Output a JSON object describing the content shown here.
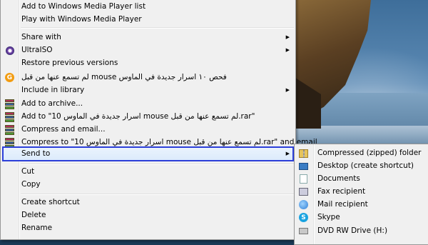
{
  "main_menu": {
    "items": [
      {
        "label": "Add to Windows Media Player list"
      },
      {
        "label": "Play with Windows Media Player"
      },
      {
        "label": "Share with",
        "arrow": "▶"
      },
      {
        "label": "UltraISO",
        "arrow": "▶"
      },
      {
        "label": "Restore previous versions"
      },
      {
        "label": "لم تسمع عنها من قبل mouse  فحص ١٠ اسرار جديدة في الماوس"
      },
      {
        "label": "Include in library",
        "arrow": "▶"
      },
      {
        "label": "Add to archive..."
      },
      {
        "label": "Add to \"10 اسرار جديدة في الماوس mouse لم تسمع عنها من قبل.rar\""
      },
      {
        "label": "Compress and email..."
      },
      {
        "label": "Compress to \"10 اسرار جديدة في الماوس mouse لم تسمع عنها من قبل.rar\" and email"
      },
      {
        "label": "Send to",
        "arrow": "▶"
      },
      {
        "label": "Cut"
      },
      {
        "label": "Copy"
      },
      {
        "label": "Create shortcut"
      },
      {
        "label": "Delete"
      },
      {
        "label": "Rename"
      }
    ]
  },
  "send_to_menu": {
    "items": [
      {
        "label": "Compressed (zipped) folder"
      },
      {
        "label": "Desktop (create shortcut)"
      },
      {
        "label": "Documents"
      },
      {
        "label": "Fax recipient"
      },
      {
        "label": "Mail recipient"
      },
      {
        "label": "Skype"
      },
      {
        "label": "DVD RW Drive (H:)"
      }
    ]
  },
  "icons": {
    "ultraiso": "ultraiso-icon",
    "orange": "orange-app-icon",
    "orange_glyph": "G",
    "skype_glyph": "S",
    "rar": "winrar-icon"
  }
}
